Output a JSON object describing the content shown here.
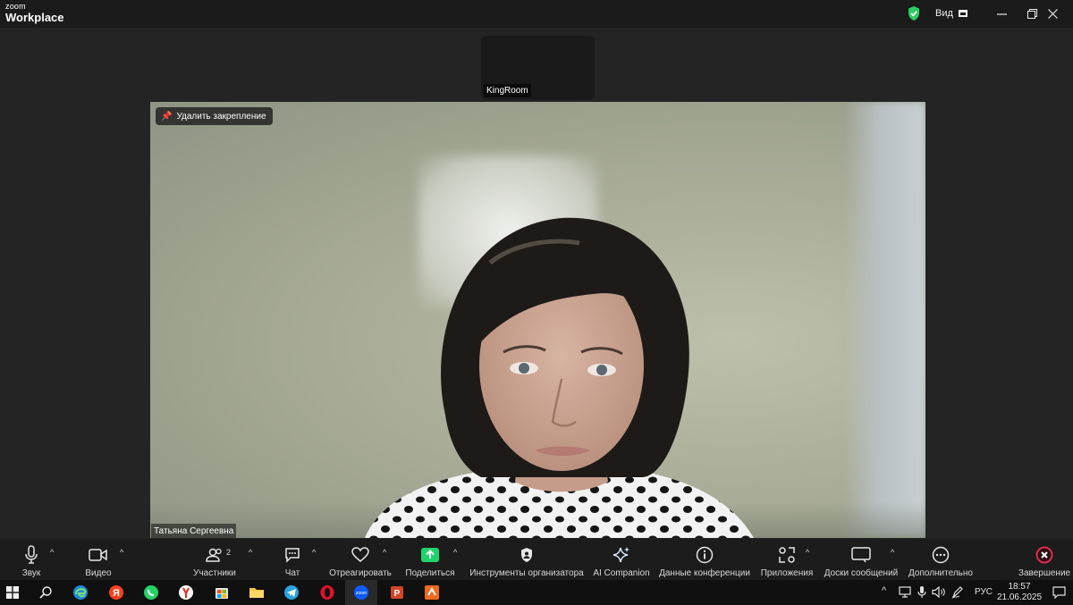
{
  "app": {
    "brand_small": "zoom",
    "brand_large": "Workplace"
  },
  "titlebar": {
    "view_label": "Вид"
  },
  "participants_strip": {
    "tile_name": "KingRoom"
  },
  "main_video": {
    "pin_label": "Удалить закрепление",
    "speaker_name": "Татьяна Сергеевна"
  },
  "toolbar": {
    "audio": "Звук",
    "video": "Видео",
    "participants": "Участники",
    "participants_count": "2",
    "chat": "Чат",
    "react": "Отреагировать",
    "share": "Поделиться",
    "host_tools": "Инструменты организатора",
    "ai": "AI Companion",
    "meeting_info": "Данные конференции",
    "apps": "Приложения",
    "whiteboards": "Доски сообщений",
    "more": "Дополнительно",
    "end": "Завершение"
  },
  "taskbar": {
    "lang": "РУС",
    "time": "18:57",
    "date": "21.06.2025"
  },
  "colors": {
    "share_green": "#1fd46c",
    "end_red": "#e02a4f",
    "shield_green": "#2ecc5f"
  }
}
